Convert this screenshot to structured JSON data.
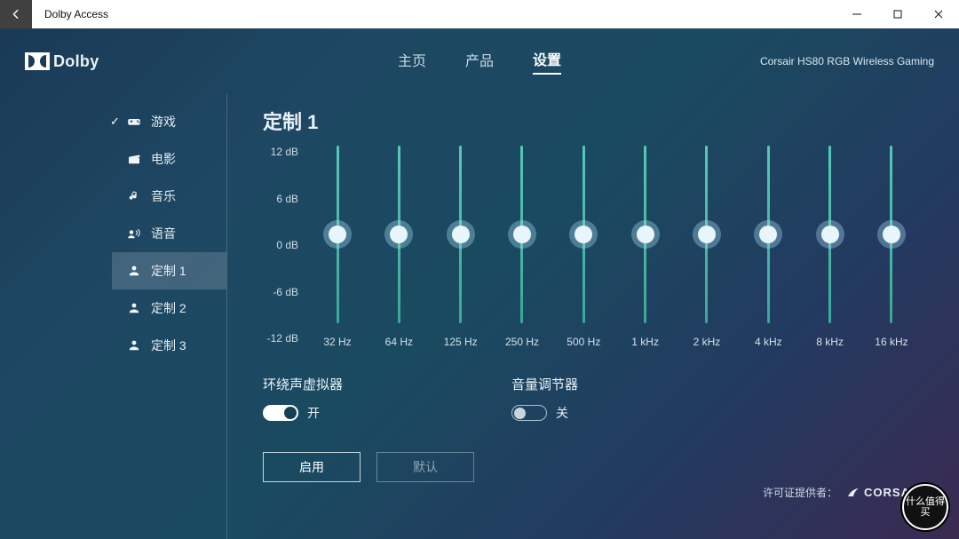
{
  "window": {
    "title": "Dolby Access"
  },
  "header": {
    "brand": "Dolby",
    "nav": {
      "home": "主页",
      "products": "产品",
      "settings": "设置"
    },
    "device": "Corsair HS80 RGB Wireless Gaming"
  },
  "sidebar": {
    "items": [
      {
        "label": "游戏",
        "selected": true
      },
      {
        "label": "电影"
      },
      {
        "label": "音乐"
      },
      {
        "label": "语音"
      },
      {
        "label": "定制 1",
        "active": true
      },
      {
        "label": "定制 2"
      },
      {
        "label": "定制 3"
      }
    ]
  },
  "preset": {
    "title": "定制 1"
  },
  "eq": {
    "db_labels": [
      "12 dB",
      "6 dB",
      "0 dB",
      "-6 dB",
      "-12 dB"
    ],
    "bands": [
      {
        "freq": "32 Hz",
        "value_db": 0
      },
      {
        "freq": "64 Hz",
        "value_db": 0
      },
      {
        "freq": "125 Hz",
        "value_db": 0
      },
      {
        "freq": "250 Hz",
        "value_db": 0
      },
      {
        "freq": "500 Hz",
        "value_db": 0
      },
      {
        "freq": "1 kHz",
        "value_db": 0
      },
      {
        "freq": "2 kHz",
        "value_db": 0
      },
      {
        "freq": "4 kHz",
        "value_db": 0
      },
      {
        "freq": "8 kHz",
        "value_db": 0
      },
      {
        "freq": "16 kHz",
        "value_db": 0
      }
    ]
  },
  "toggles": {
    "surround": {
      "label": "环绕声虚拟器",
      "state_text": "开",
      "on": true
    },
    "volume": {
      "label": "音量调节器",
      "state_text": "关",
      "on": false
    }
  },
  "actions": {
    "apply": "启用",
    "default": "默认"
  },
  "footer": {
    "license_prefix": "许可证提供者：",
    "licensor": "CORSAIR"
  },
  "watermark": "什么值得买"
}
